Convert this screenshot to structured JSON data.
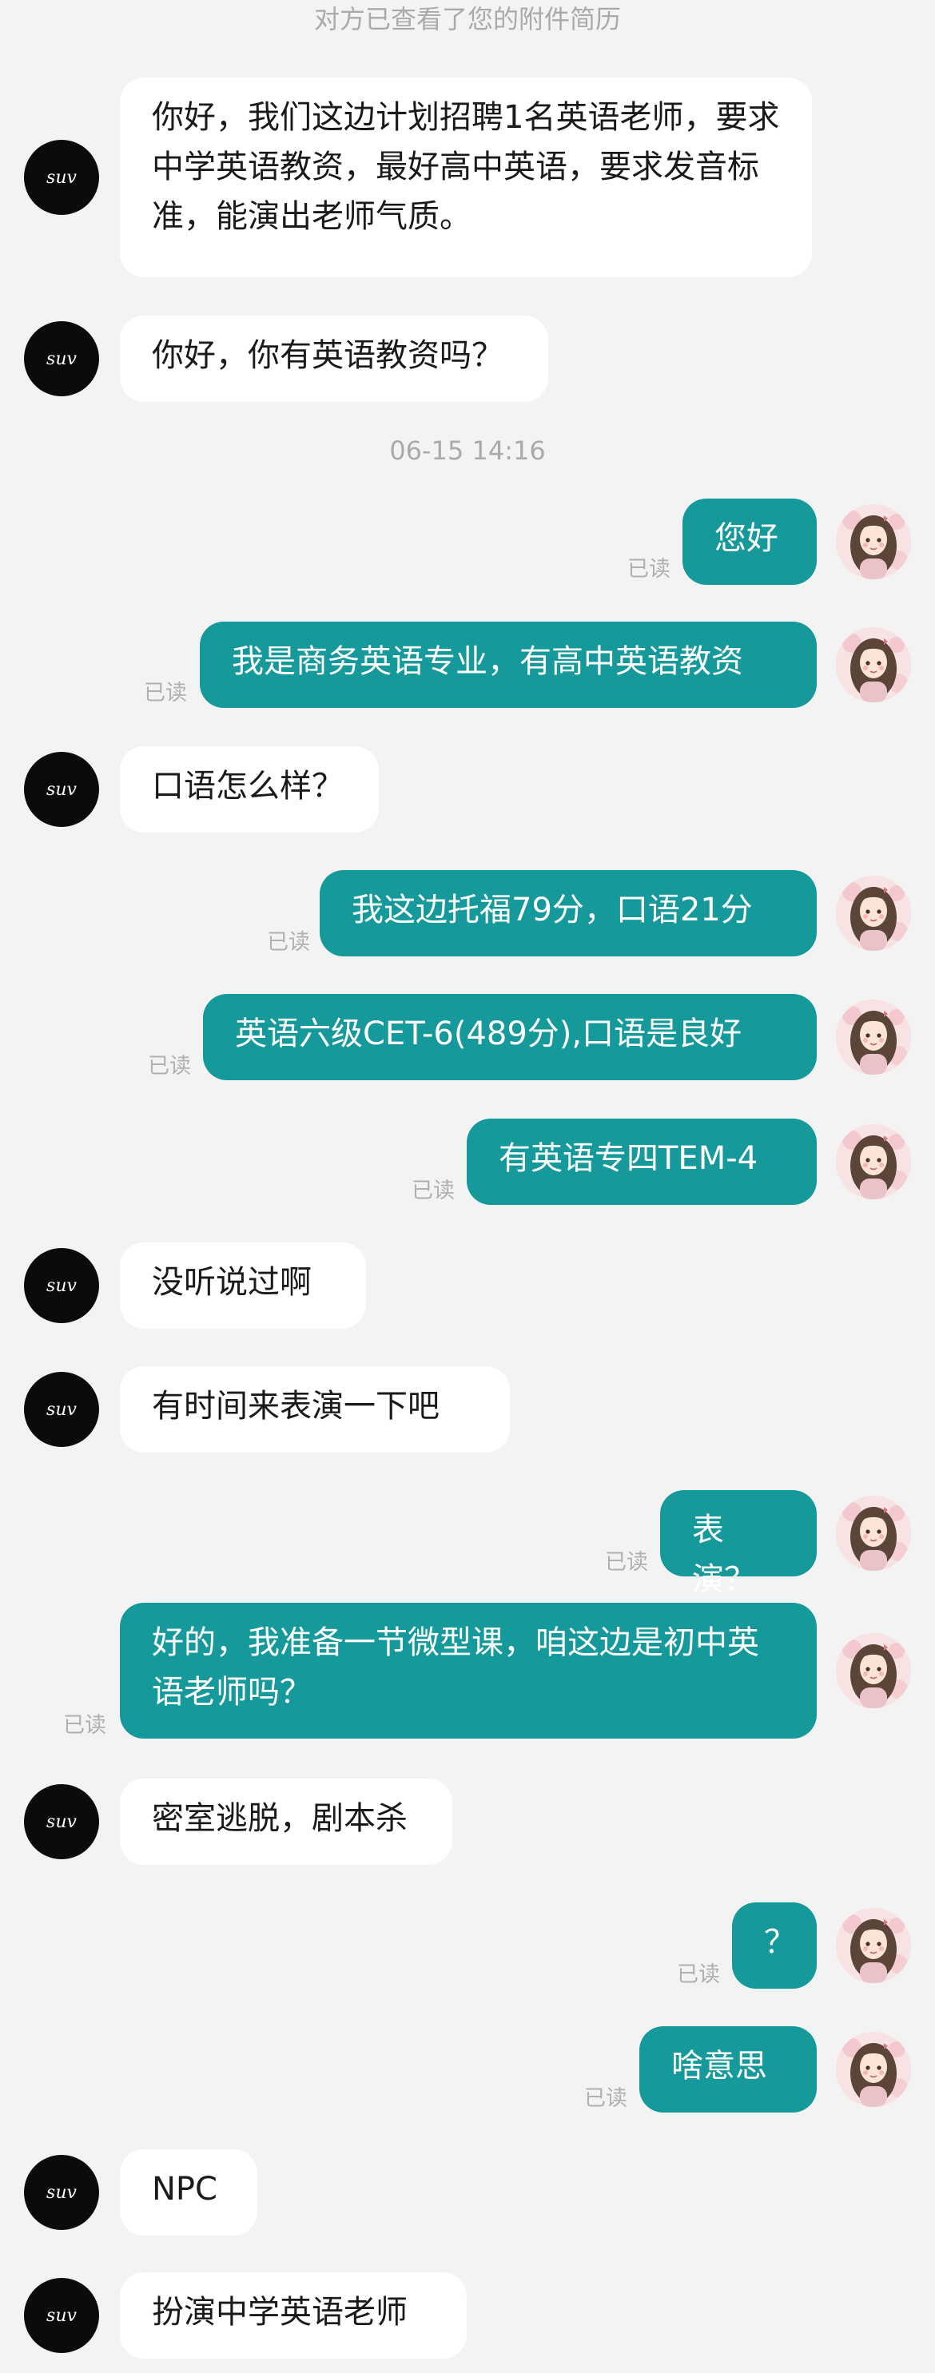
{
  "notice": "对方已查看了您的附件简历",
  "timestamp": "06-15 14:16",
  "read_label": "已读",
  "colors": {
    "background": "#f3f3f3",
    "incoming_bubble": "#ffffff",
    "outgoing_bubble": "#16999a",
    "read_status": "#b0b0b0"
  },
  "contact_avatar_mark": "suv",
  "messages": [
    {
      "from": "them",
      "text": "你好，我们这边计划招聘1名英语老师，要求中学英语教资，最好高中英语，要求发音标准，能演出老师气质。"
    },
    {
      "from": "them",
      "text": "你好，你有英语教资吗？"
    },
    {
      "from": "me",
      "text": "您好",
      "read": "已读"
    },
    {
      "from": "me",
      "text": "我是商务英语专业，有高中英语教资",
      "read": "已读"
    },
    {
      "from": "them",
      "text": "口语怎么样？"
    },
    {
      "from": "me",
      "text": "我这边托福79分，口语21分",
      "read": "已读"
    },
    {
      "from": "me",
      "text": "英语六级CET-6(489分),口语是良好",
      "read": "已读"
    },
    {
      "from": "me",
      "text": "有英语专四TEM-4",
      "read": "已读"
    },
    {
      "from": "them",
      "text": "没听说过啊"
    },
    {
      "from": "them",
      "text": "有时间来表演一下吧"
    },
    {
      "from": "me",
      "text": "表演？",
      "read": "已读"
    },
    {
      "from": "me",
      "text": "好的，我准备一节微型课，咱这边是初中英语老师吗？",
      "read": "已读"
    },
    {
      "from": "them",
      "text": "密室逃脱，剧本杀"
    },
    {
      "from": "me",
      "text": "？",
      "read": "已读"
    },
    {
      "from": "me",
      "text": "啥意思",
      "read": "已读"
    },
    {
      "from": "them",
      "text": "NPC"
    },
    {
      "from": "them",
      "text": "扮演中学英语老师"
    }
  ]
}
